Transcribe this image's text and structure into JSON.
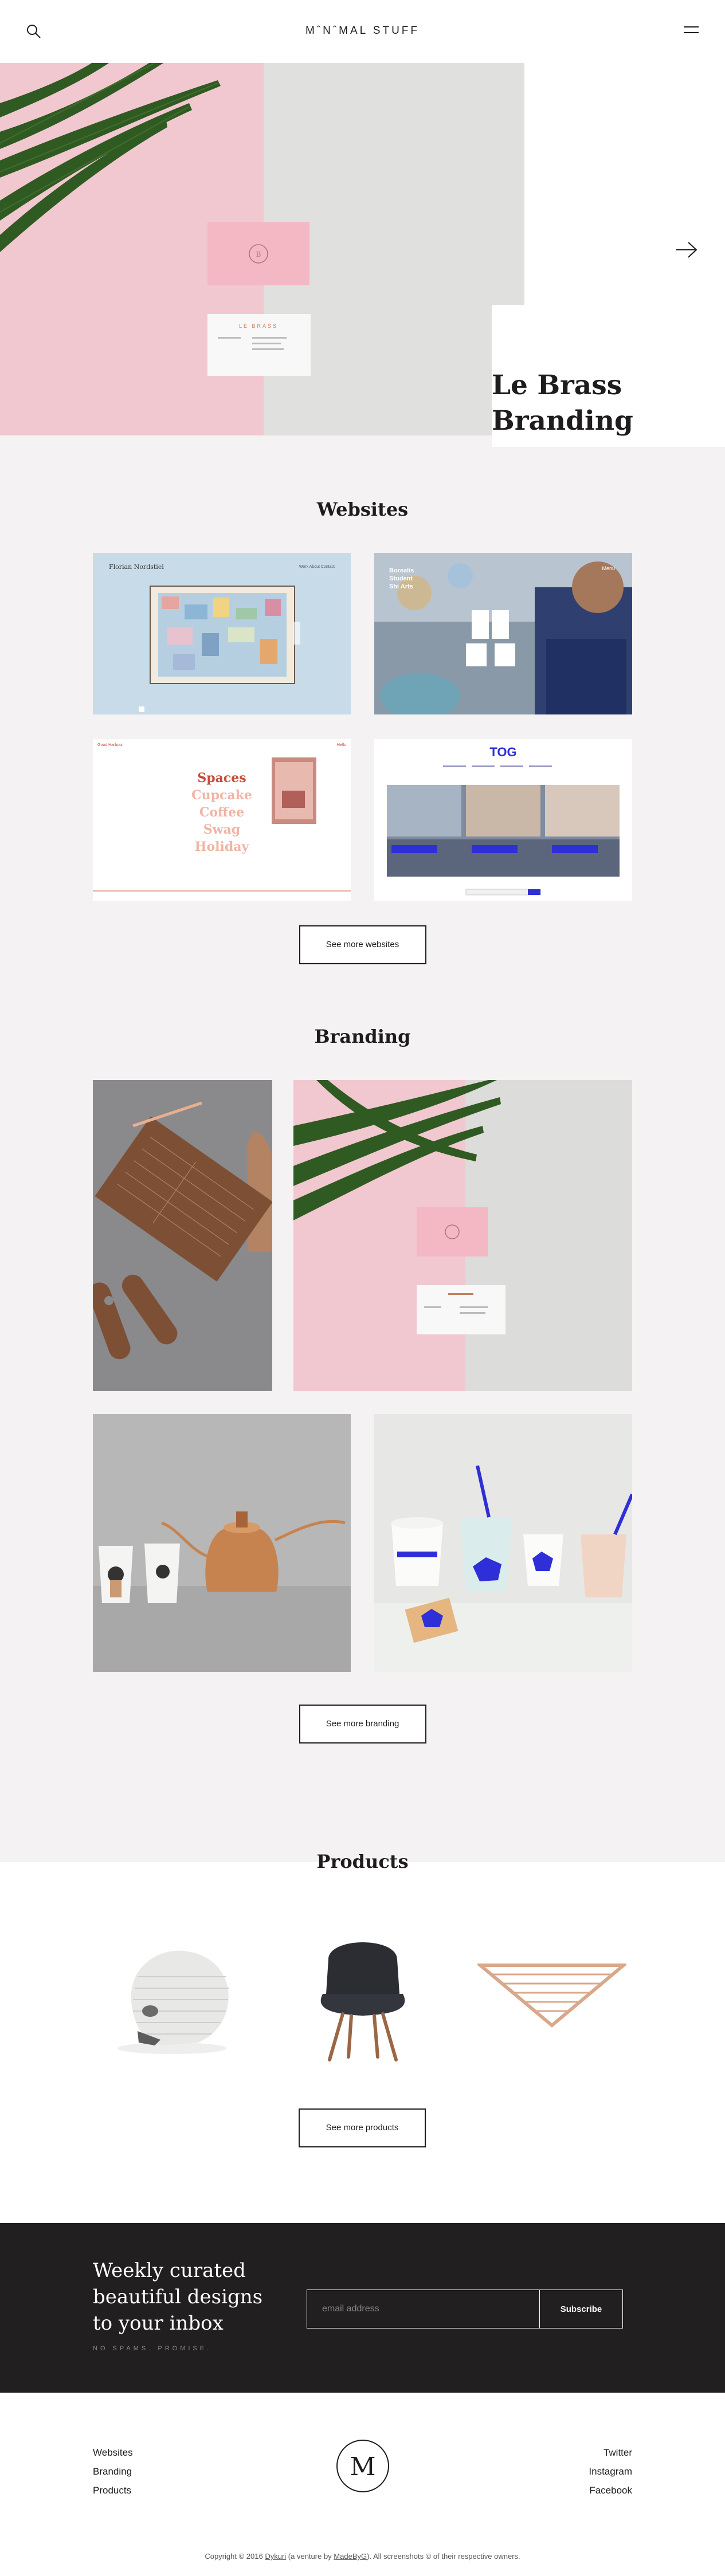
{
  "header": {
    "logo": "MˆNˆMAL STUFF",
    "search_icon": "search-icon",
    "menu_icon": "hamburger-menu-icon"
  },
  "hero": {
    "title_line1": "Le Brass",
    "title_line2": "Branding",
    "card_text": "LE BRASS",
    "next_icon": "arrow-right-icon"
  },
  "websites": {
    "title": "Websites",
    "cards": [
      {
        "label": "Florian Nordstiel",
        "nav": "Work  About  Contact"
      },
      {
        "label": "Arts",
        "lines": [
          "Borealis",
          "Student",
          "Shi Arts"
        ],
        "nav": "Menu"
      },
      {
        "label": "Spaces",
        "words": [
          "Spaces",
          "Cupcake",
          "Coffee",
          "Swag",
          "Holiday"
        ],
        "brand": "Good Harbour",
        "corner": "Hello"
      },
      {
        "label": "TOG",
        "logo": "TOG"
      }
    ],
    "button": "See more websites"
  },
  "branding": {
    "title": "Branding",
    "button": "See more branding"
  },
  "products": {
    "title": "Products",
    "button": "See more products"
  },
  "newsletter": {
    "title": "Weekly curated beautiful designs to your inbox",
    "tagline": "NO SPAMS. PROMISE.",
    "placeholder": "email address",
    "subscribe": "Subscribe"
  },
  "footer": {
    "left_links": [
      "Websites",
      "Branding",
      "Products"
    ],
    "right_links": [
      "Twitter",
      "Instagram",
      "Facebook"
    ],
    "monogram": "M",
    "copy_prefix": "Copyright © 2016 ",
    "copy_link1": "Dykuri",
    "copy_middle": " (a venture by ",
    "copy_link2": "MadeByG",
    "copy_suffix": "). All screenshots © of their respective owners."
  },
  "colors": {
    "dark": "#221f20",
    "grey_bg": "#f4f2f3",
    "pink": "#f3c9d1",
    "accent_blue": "#2e2fd6",
    "copper": "#c98a5c"
  }
}
